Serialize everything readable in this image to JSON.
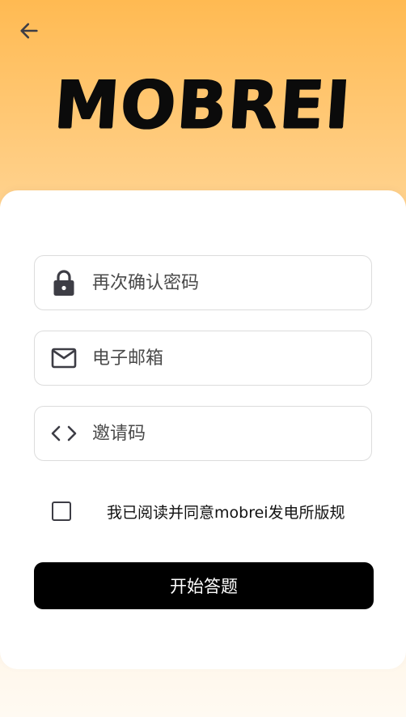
{
  "header": {
    "back_icon": "arrow-left-icon",
    "logo_text": "MOBREI"
  },
  "form": {
    "confirm_password": {
      "icon": "lock-icon",
      "placeholder": "再次确认密码",
      "value": ""
    },
    "email": {
      "icon": "mail-icon",
      "placeholder": "电子邮箱",
      "value": ""
    },
    "invite_code": {
      "icon": "code-icon",
      "placeholder": "邀请码",
      "value": ""
    },
    "agreement": {
      "checked": false,
      "label": "我已阅读并同意mobrei发电所版规"
    },
    "submit_label": "开始答题"
  },
  "colors": {
    "header_gradient_top": "#FFBA52",
    "header_gradient_bottom": "#FFD089",
    "button_bg": "#000000",
    "icon_color": "#3d3d45"
  }
}
